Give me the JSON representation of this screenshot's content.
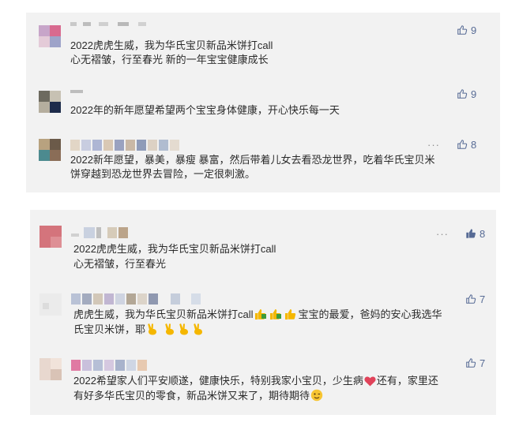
{
  "panel1": {
    "comments": [
      {
        "line1": "2022虎虎生威，我为华氏宝贝新品米饼打call",
        "line2": "心无褶皱，行至春光 新的一年宝宝健康成长",
        "likes": "9"
      },
      {
        "line1": "2022年的新年愿望希望两个宝宝身体健康，开心快乐每一天",
        "likes": "9"
      },
      {
        "line1": "2022新年愿望，暴美，暴瘦 暴富，然后带着儿女去看恐龙世界，吃着华氏宝贝米",
        "line2": "饼穿越到恐龙世界去冒险，一定很刺激。",
        "likes": "8",
        "more": "···"
      }
    ]
  },
  "panel2": {
    "comments": [
      {
        "line1": "2022虎虎生威，我为华氏宝贝新品米饼打call",
        "line2": "心无褶皱，行至春光",
        "likes": "8",
        "more": "···"
      },
      {
        "line1_a": "虎虎生威，我为华氏宝贝新品米饼打call",
        "line1_b": "宝宝的最爱，爸妈的安心我选华",
        "line2": "氏宝贝米饼，耶",
        "likes": "7"
      },
      {
        "line1": "2022希望家人们平安顺遂，健康快乐，特别我家小宝贝，少生病",
        "line1_b": "还有，家里还",
        "line2": "有好多华氏宝贝的零食，新品米饼又来了，期待期待",
        "likes": "7"
      }
    ]
  },
  "colors": {
    "panel_bg": "#f2f2f2",
    "like_color": "#576b95",
    "text_color": "#2b2b2b"
  },
  "icons": {
    "like_outline": "thumbs-up-outline-icon",
    "like_filled": "thumbs-up-filled-icon",
    "more": "more-dots-icon",
    "thumbs_emoji": "thumbs-up-emoji",
    "victory_emoji": "victory-hand-emoji",
    "heart_emoji": "heart-emoji",
    "wink_emoji": "wink-face-emoji"
  }
}
